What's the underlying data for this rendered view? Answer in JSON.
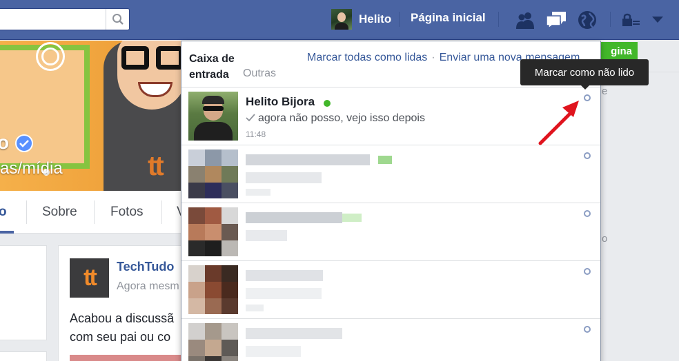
{
  "topbar": {
    "search_placeholder": "",
    "user_name": "Helito",
    "home_label": "Página inicial",
    "icons": [
      "friends-icon",
      "messages-icon",
      "notifications-globe-icon",
      "privacy-lock-icon",
      "settings-chevron-icon"
    ]
  },
  "page": {
    "cover_title_fragment": "o",
    "cover_subtitle_fragment": "as/mídia",
    "cover_logo": "tt",
    "tabs": [
      {
        "label": "o"
      },
      {
        "label": "Sobre"
      },
      {
        "label": "Fotos"
      },
      {
        "label": "V"
      }
    ],
    "post": {
      "logo": "tt",
      "author": "TechTudo",
      "time": "Agora mesm",
      "text_line1": "Acabou a discussã",
      "text_line2": "com seu pai ou co"
    },
    "right": {
      "button_label": "gina",
      "char1": "e",
      "char2": "o"
    }
  },
  "inbox": {
    "title": "Caixa de entrada",
    "other_label": "Outras",
    "mark_all_read": "Marcar todas como lidas",
    "separator": "·",
    "send_new": "Enviar uma nova mensagem",
    "conversations": [
      {
        "name": "Helito Bijora",
        "online": true,
        "snippet": "agora não posso, vejo isso depois",
        "time": "11:48",
        "blurred": false
      },
      {
        "name": "",
        "snippet": "",
        "time": "",
        "blurred": true,
        "online": true
      },
      {
        "name": "",
        "snippet": "",
        "time": "",
        "blurred": true,
        "online": true
      },
      {
        "name": "",
        "snippet": "",
        "time": "",
        "blurred": true,
        "online": false
      },
      {
        "name": "",
        "snippet": "",
        "time": "",
        "blurred": true,
        "online": false
      }
    ]
  },
  "tooltip": {
    "text": "Marcar como não lido"
  },
  "colors": {
    "brand_blue": "#4a64a3",
    "link_blue": "#365899",
    "online_green": "#42b72a",
    "annotation_red": "#e0141e"
  }
}
